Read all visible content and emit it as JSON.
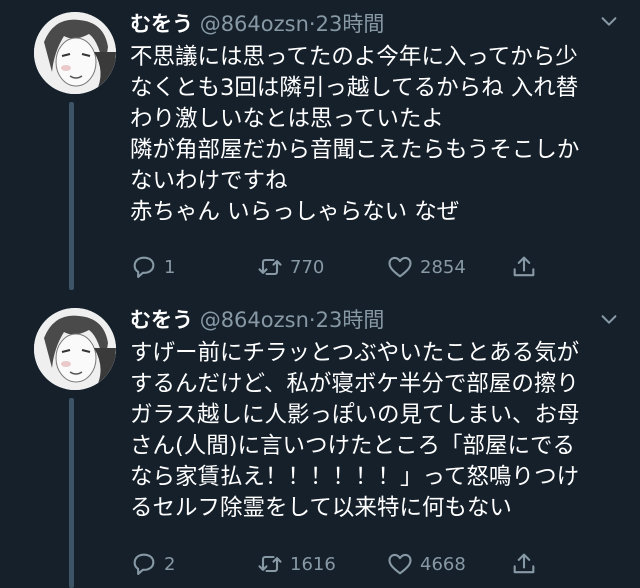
{
  "tweets": [
    {
      "name": "むをう",
      "handle": "@864ozsn",
      "separator": "·",
      "time": "23時間",
      "lines": [
        "不思議には思ってたのよ今年に入ってから少",
        "なくとも3回は隣引っ越してるからね 入れ替",
        "わり激しいなとは思っていたよ",
        "隣が角部屋だから音聞こえたらもうそこしか",
        "ないわけですね",
        "赤ちゃん いらっしゃらない なぜ"
      ],
      "replies": "1",
      "retweets": "770",
      "likes": "2854"
    },
    {
      "name": "むをう",
      "handle": "@864ozsn",
      "separator": "·",
      "time": "23時間",
      "lines": [
        "すげー前にチラッとつぶやいたことある気が",
        "するんだけど、私が寝ボケ半分で部屋の擦り",
        "ガラス越しに人影っぽいの見てしまい、お母",
        "さん(人間)に言いつけたところ「部屋にでる",
        "なら家賃払え！！！！！！」って怒鳴りつけ",
        "るセルフ除霊をして以来特に何もない"
      ],
      "replies": "2",
      "retweets": "1616",
      "likes": "4668"
    }
  ],
  "icons": {
    "reply": "reply-icon",
    "retweet": "retweet-icon",
    "like": "heart-icon",
    "share": "share-icon",
    "menu": "chevron-down-icon"
  },
  "colors": {
    "background": "#15202b",
    "secondary_text": "#8899a6",
    "thread_line": "#3d5466"
  }
}
